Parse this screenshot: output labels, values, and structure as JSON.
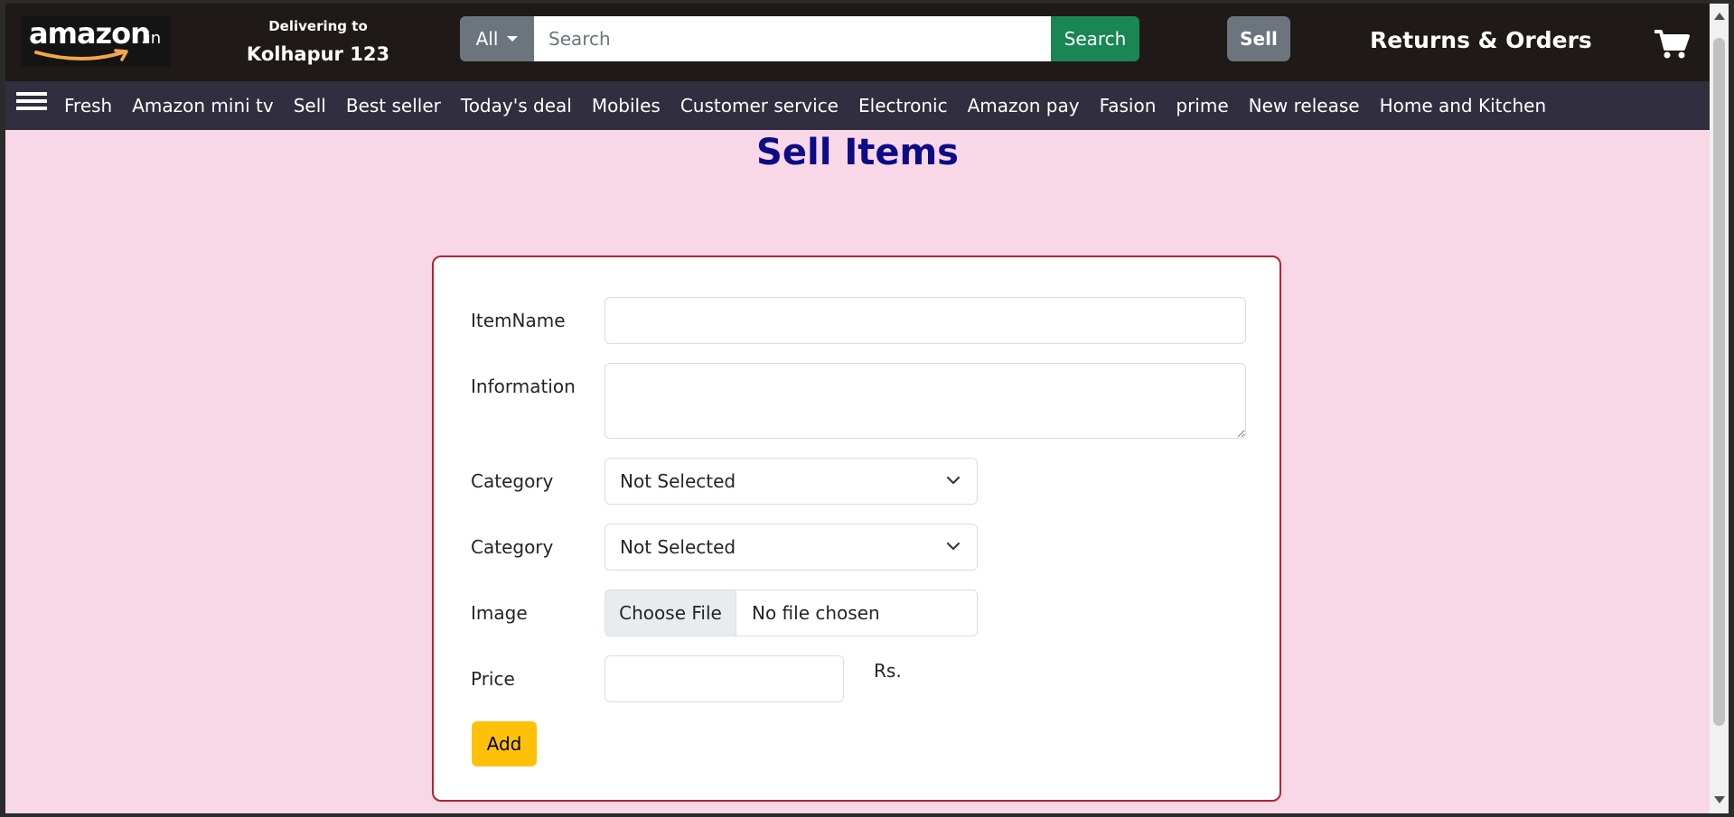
{
  "header": {
    "logo_text": "amazon",
    "logo_tld": ".in",
    "deliver_label": "Delivering to",
    "deliver_location": "Kolhapur 123",
    "search": {
      "category": "All",
      "placeholder": "Search",
      "value": "",
      "button_label": "Search"
    },
    "sell_label": "Sell",
    "returns_label": "Returns & Orders",
    "cart_icon": "cart-icon"
  },
  "nav": {
    "menu_icon": "hamburger-menu-icon",
    "links": [
      "Fresh",
      "Amazon mini tv",
      "Sell",
      "Best seller",
      "Today's deal",
      "Mobiles",
      "Customer service",
      "Electronic",
      "Amazon pay",
      "Fasion",
      "prime",
      "New release",
      "Home and Kitchen"
    ]
  },
  "page": {
    "title": "Sell Items",
    "title_color": "#0d0c86",
    "background": "#f8d7e7"
  },
  "form": {
    "item_name_label": "ItemName",
    "item_name_value": "",
    "information_label": "Information",
    "information_value": "",
    "category1_label": "Category",
    "category1_value": "Not Selected",
    "category2_label": "Category",
    "category2_value": "Not Selected",
    "image_label": "Image",
    "choose_file_label": "Choose File",
    "no_file_text": "No file chosen",
    "price_label": "Price",
    "price_value": "",
    "currency_label": "Rs.",
    "add_button_label": "Add",
    "add_button_color": "#ffc107",
    "border_color": "#b5232f"
  }
}
